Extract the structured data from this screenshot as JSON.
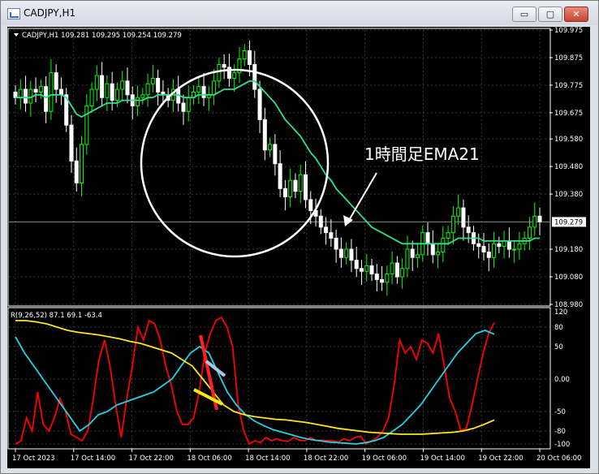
{
  "window": {
    "title": "CADJPY,H1",
    "minimize_label": "▭",
    "maximize_label": "▢",
    "close_label": "✕",
    "icon": "chart-icon"
  },
  "chart_data": [
    {
      "type": "candlestick",
      "header": "CADJPY,H1  109.281 109.295 109.254 109.279",
      "symbol": "CADJPY,H1",
      "ohlc_last": [
        109.281,
        109.295,
        109.254,
        109.279
      ],
      "ylim": [
        108.98,
        109.975
      ],
      "y_ticks": [
        "109.975",
        "109.875",
        "109.775",
        "109.675",
        "109.580",
        "109.480",
        "109.380",
        "109.279",
        "109.180",
        "109.080",
        "108.980"
      ],
      "current_price": "109.279",
      "grid": true,
      "grid_color": "#3a3a3a",
      "up_color": "#00ff00",
      "down_color": "#ffffff",
      "ema_color": "#2ee28a",
      "annotation": "1時間足EMA21",
      "annotation_color": "#ffffff",
      "candles_close": [
        109.73,
        109.76,
        109.71,
        109.76,
        109.75,
        109.77,
        109.68,
        109.82,
        109.76,
        109.74,
        109.63,
        109.5,
        109.42,
        109.56,
        109.7,
        109.76,
        109.81,
        109.73,
        109.78,
        109.72,
        109.76,
        109.79,
        109.74,
        109.7,
        109.73,
        109.74,
        109.78,
        109.8,
        109.75,
        109.74,
        109.72,
        109.76,
        109.71,
        109.68,
        109.73,
        109.75,
        109.77,
        109.73,
        109.74,
        109.79,
        109.85,
        109.84,
        109.8,
        109.82,
        109.87,
        109.9,
        109.85,
        109.76,
        109.65,
        109.54,
        109.56,
        109.49,
        109.4,
        109.37,
        109.43,
        109.39,
        109.45,
        109.36,
        109.32,
        109.3,
        109.26,
        109.24,
        109.22,
        109.18,
        109.15,
        109.18,
        109.14,
        109.11,
        109.1,
        109.12,
        109.09,
        109.07,
        109.06,
        109.09,
        109.13,
        109.08,
        109.11,
        109.18,
        109.15,
        109.16,
        109.24,
        109.2,
        109.16,
        109.17,
        109.22,
        109.24,
        109.3,
        109.33,
        109.26,
        109.24,
        109.2,
        109.19,
        109.17,
        109.15,
        109.2,
        109.19,
        109.21,
        109.18,
        109.18,
        109.2,
        109.22,
        109.26,
        109.3,
        109.28
      ],
      "ema21": [
        109.73,
        109.73,
        109.73,
        109.73,
        109.74,
        109.74,
        109.73,
        109.74,
        109.74,
        109.74,
        109.73,
        109.7,
        109.67,
        109.66,
        109.67,
        109.68,
        109.69,
        109.7,
        109.71,
        109.71,
        109.71,
        109.72,
        109.72,
        109.72,
        109.72,
        109.72,
        109.73,
        109.73,
        109.74,
        109.74,
        109.74,
        109.74,
        109.74,
        109.73,
        109.73,
        109.73,
        109.74,
        109.74,
        109.74,
        109.74,
        109.75,
        109.76,
        109.76,
        109.76,
        109.77,
        109.78,
        109.79,
        109.79,
        109.77,
        109.75,
        109.73,
        109.71,
        109.68,
        109.65,
        109.63,
        109.61,
        109.59,
        109.56,
        109.53,
        109.51,
        109.48,
        109.45,
        109.43,
        109.4,
        109.38,
        109.36,
        109.34,
        109.32,
        109.3,
        109.28,
        109.26,
        109.25,
        109.24,
        109.23,
        109.22,
        109.21,
        109.2,
        109.2,
        109.2,
        109.2,
        109.2,
        109.2,
        109.2,
        109.2,
        109.2,
        109.2,
        109.21,
        109.22,
        109.22,
        109.22,
        109.22,
        109.22,
        109.21,
        109.21,
        109.21,
        109.21,
        109.21,
        109.21,
        109.21,
        109.21,
        109.21,
        109.21,
        109.22,
        109.22
      ]
    },
    {
      "type": "line",
      "header": "R(9,26,52) 87.1 69.1 -63.4",
      "ylim": [
        -100,
        100
      ],
      "y_ticks": [
        "120",
        "80",
        "50",
        "0.00",
        "-50",
        "-80",
        "-100"
      ],
      "x_labels": [
        "17 Oct 2023",
        "17 Oct 14:00",
        "17 Oct 22:00",
        "18 Oct 06:00",
        "18 Oct 14:00",
        "18 Oct 22:00",
        "19 Oct 06:00",
        "19 Oct 14:00",
        "19 Oct 22:00",
        "20 Oct 06:00"
      ],
      "series": [
        {
          "color": "#ff0000",
          "values": [
            -100,
            -95,
            -60,
            -80,
            -20,
            -70,
            -80,
            -60,
            -30,
            -50,
            -85,
            -90,
            -95,
            -80,
            -30,
            30,
            60,
            20,
            -40,
            -90,
            -30,
            20,
            80,
            60,
            90,
            85,
            60,
            20,
            -10,
            -50,
            -70,
            -70,
            -60,
            -20,
            40,
            70,
            90,
            95,
            80,
            50,
            -40,
            -80,
            -100,
            -95,
            -98,
            -90,
            -95,
            -92,
            -95,
            -96,
            -90,
            -94,
            -95,
            -90,
            -95,
            -94,
            -95,
            -95,
            -97,
            -92,
            -95,
            -90,
            -88,
            -100,
            -95,
            -90,
            -80,
            -60,
            -10,
            60,
            40,
            50,
            30,
            60,
            55,
            40,
            70,
            20,
            -30,
            -50,
            -80,
            -75,
            -40,
            0,
            40,
            70,
            87
          ]
        },
        {
          "color": "#22d3e6",
          "values": [
            65,
            40,
            20,
            0,
            -20,
            -40,
            -60,
            -80,
            -70,
            -55,
            -50,
            -40,
            -35,
            -30,
            -25,
            -20,
            -10,
            0,
            20,
            40,
            50,
            40,
            10,
            -20,
            -40,
            -55,
            -65,
            -72,
            -78,
            -82,
            -86,
            -90,
            -93,
            -95,
            -97,
            -98,
            -99,
            -100,
            -98,
            -95,
            -90,
            -80,
            -70,
            -55,
            -40,
            -20,
            0,
            20,
            40,
            55,
            70,
            75,
            69
          ]
        },
        {
          "color": "#ffe61a",
          "values": [
            90,
            90,
            88,
            85,
            80,
            75,
            72,
            70,
            68,
            65,
            62,
            58,
            55,
            50,
            45,
            40,
            30,
            20,
            0,
            -20,
            -40,
            -50,
            -55,
            -58,
            -60,
            -62,
            -63,
            -65,
            -67,
            -70,
            -73,
            -76,
            -78,
            -80,
            -82,
            -83,
            -84,
            -85,
            -85,
            -85,
            -84,
            -83,
            -82,
            -80,
            -76,
            -70,
            -63
          ]
        }
      ]
    }
  ]
}
